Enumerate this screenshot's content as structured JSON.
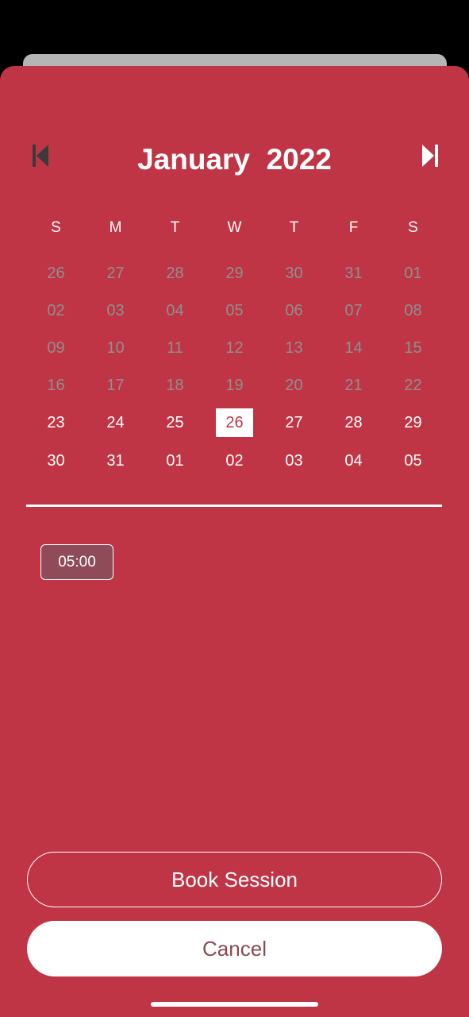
{
  "colors": {
    "sheet_background": "#c03545",
    "muted_day": "#8f8f8f",
    "selected_day_bg": "#ffffff",
    "slot_background": "#8f4b57",
    "cancel_text": "#8a4a52",
    "nav_icon": "#3a3a3a"
  },
  "calendar": {
    "month": "January",
    "year": "2022",
    "prev_icon": "skip-previous-icon",
    "next_icon": "skip-next-icon",
    "weekdays": [
      "S",
      "M",
      "T",
      "W",
      "T",
      "F",
      "S"
    ],
    "weeks": [
      [
        "26",
        "27",
        "28",
        "29",
        "30",
        "31",
        "01"
      ],
      [
        "02",
        "03",
        "04",
        "05",
        "06",
        "07",
        "08"
      ],
      [
        "09",
        "10",
        "11",
        "12",
        "13",
        "14",
        "15"
      ],
      [
        "16",
        "17",
        "18",
        "19",
        "20",
        "21",
        "22"
      ],
      [
        "23",
        "24",
        "25",
        "26",
        "27",
        "28",
        "29"
      ],
      [
        "30",
        "31",
        "01",
        "02",
        "03",
        "04",
        "05"
      ]
    ],
    "selected_week": 4,
    "selected_day_index": 3,
    "first_active_week": 4
  },
  "time_slots": [
    "05:00"
  ],
  "actions": {
    "book_label": "Book Session",
    "cancel_label": "Cancel"
  }
}
